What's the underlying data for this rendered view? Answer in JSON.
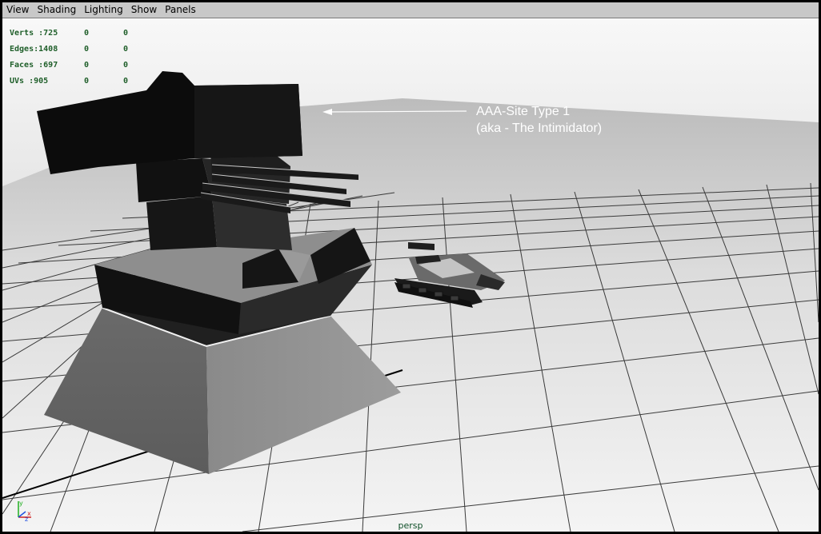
{
  "menu": {
    "items": [
      "View",
      "Shading",
      "Lighting",
      "Show",
      "Panels"
    ]
  },
  "hud": {
    "stats": [
      {
        "label": "Verts",
        "value": "725",
        "selected": "0",
        "triangles": "0"
      },
      {
        "label": "Edges",
        "value": "1408",
        "selected": "0",
        "triangles": "0"
      },
      {
        "label": "Faces",
        "value": "697",
        "selected": "0",
        "triangles": "0"
      },
      {
        "label": "UVs",
        "value": "905",
        "selected": "0",
        "triangles": "0"
      }
    ]
  },
  "annotation": {
    "line1": "AAA-Site Type 1",
    "line2": "(aka - The Intimidator)"
  },
  "viewport": {
    "camera": "persp"
  },
  "axis_gizmo": {
    "x": "x",
    "y": "y",
    "z": "z"
  },
  "colors": {
    "hud_text": "#1f5f2a",
    "annotation": "#ffffff",
    "camera_label": "#0f4f28",
    "axis_x": "#d02020",
    "axis_y": "#20b020",
    "axis_z": "#2050e0"
  }
}
